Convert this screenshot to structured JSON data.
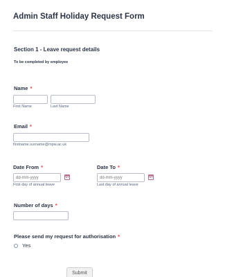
{
  "form": {
    "title": "Admin Staff Holiday Request Form"
  },
  "section": {
    "title": "Section 1 - Leave request details",
    "subtitle": "To be completed by employee"
  },
  "name_field": {
    "label": "Name",
    "required_mark": "*",
    "first_sublabel": "First Name",
    "last_sublabel": "Last Name",
    "first_value": "",
    "last_value": ""
  },
  "email_field": {
    "label": "Email",
    "required_mark": "*",
    "value": "",
    "sublabel": "firstname.surname@mpw.ac.uk"
  },
  "date_from": {
    "label": "Date From",
    "required_mark": "*",
    "placeholder": "dd-mm-yyyy",
    "sublabel": "First day of annual leave",
    "icon": "calendar-icon"
  },
  "date_to": {
    "label": "Date To",
    "required_mark": "*",
    "placeholder": "dd-mm-yyyy",
    "sublabel": "Last day of annual leave",
    "icon": "calendar-icon"
  },
  "days_field": {
    "label": "Number of days",
    "required_mark": "*",
    "value": ""
  },
  "authorisation": {
    "label": "Please send my request for authorisation",
    "required_mark": "*",
    "option": "Yes",
    "checked": false
  },
  "submit": {
    "label": "Submit"
  }
}
